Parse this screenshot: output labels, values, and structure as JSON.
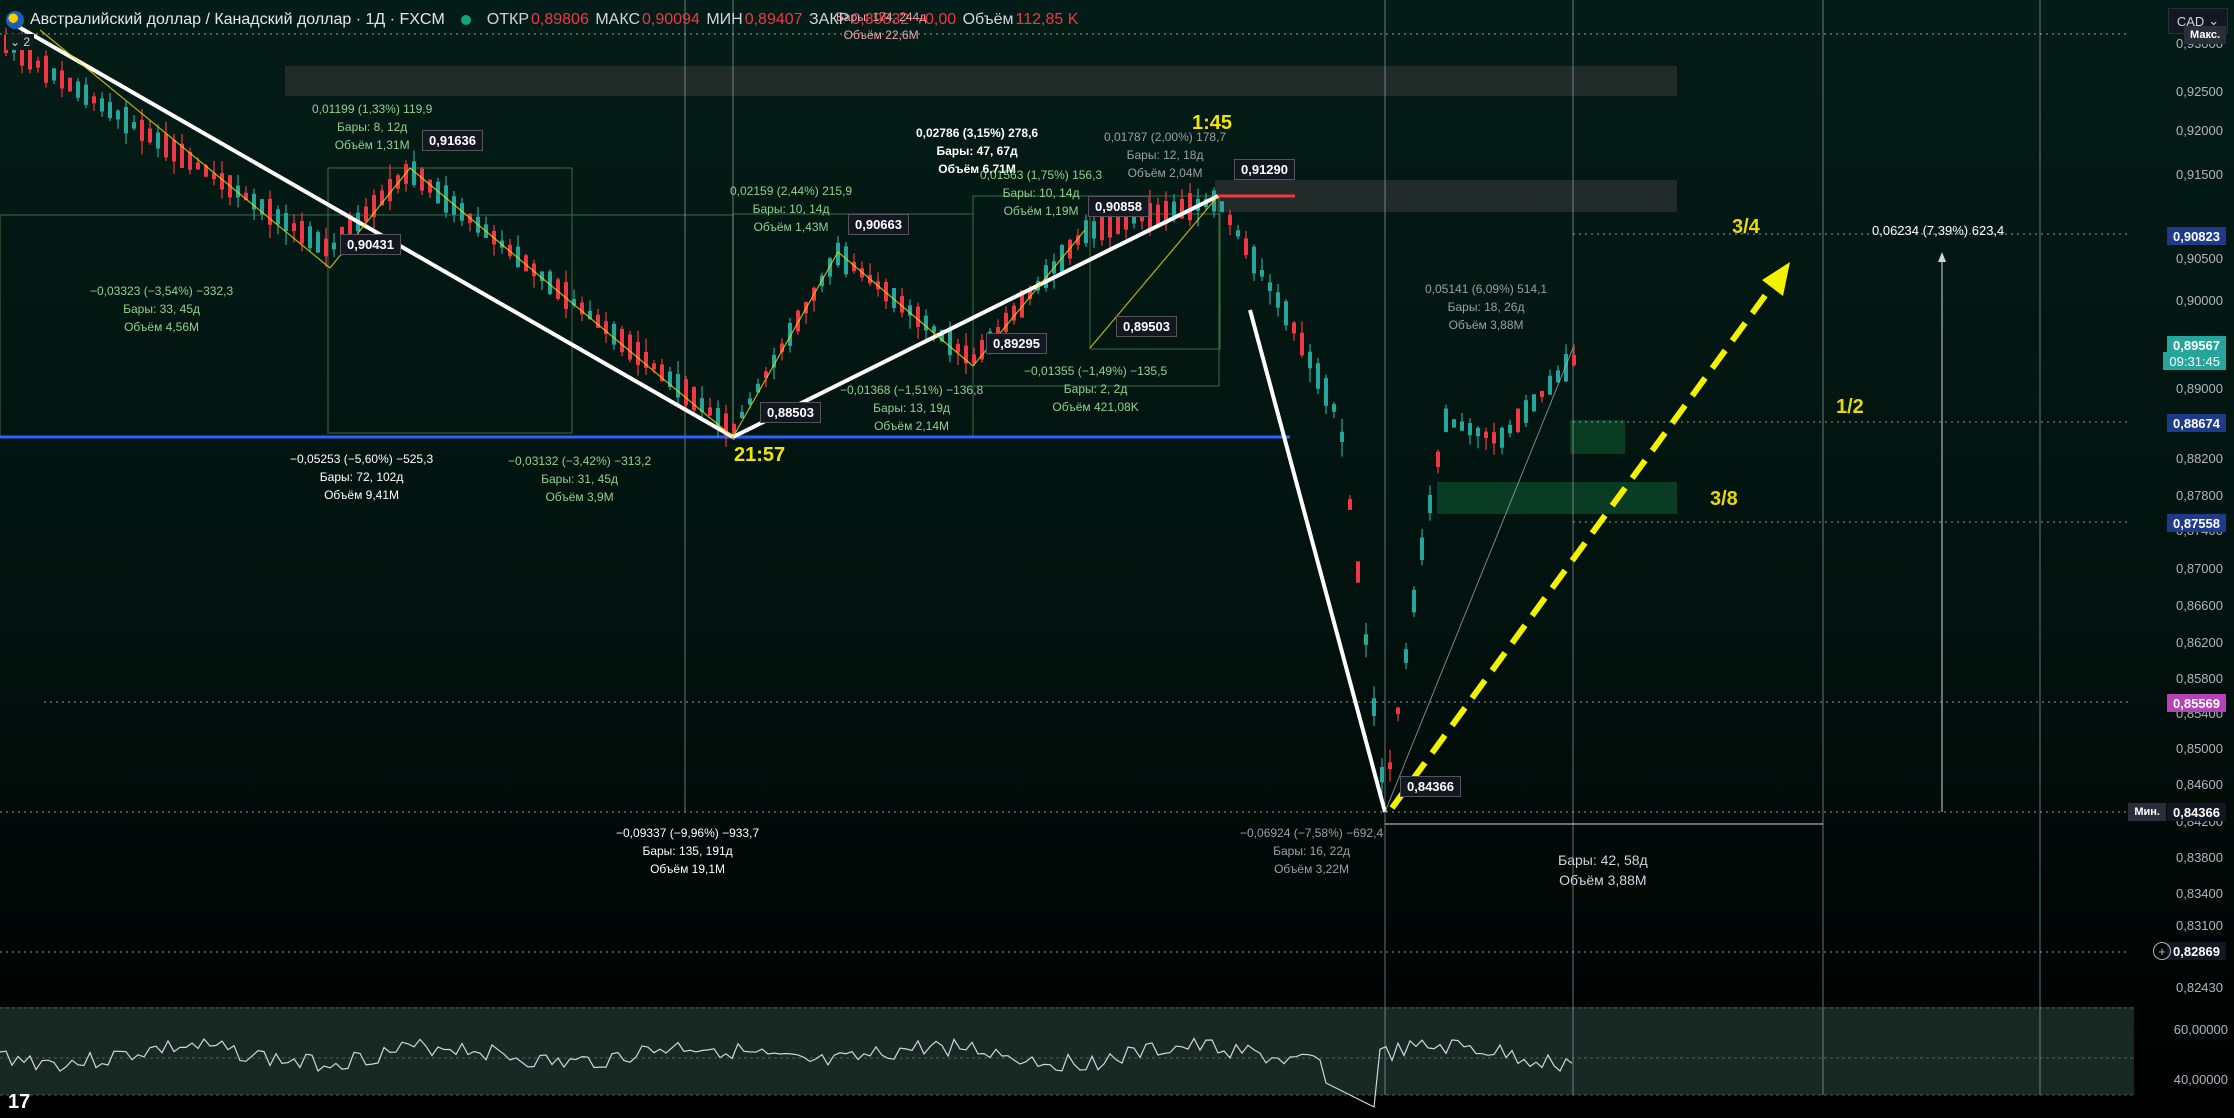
{
  "header": {
    "symbol": "Австралийский доллар / Канадский доллар · 1Д · FXCM",
    "open_label": "ОТКР",
    "open_value": "0,89806",
    "high_label": "МАКС",
    "high_value": "0,90094",
    "low_label": "МИН",
    "low_value": "0,89407",
    "close_label": "ЗАКР",
    "close_value": "0,89832",
    "change_value": "−0,00",
    "volume_label": "Объём",
    "volume_value": "112,85 K",
    "currency": "CAD",
    "layers_count": "2",
    "top_stat": "Бары: 174, 244д",
    "top_volume": "Объём 22,6M"
  },
  "price_axis": {
    "ticks": [
      "0,93000",
      "0,92500",
      "0,92000",
      "0,91500",
      "0,90500",
      "0,90000",
      "0,89000",
      "0,88200",
      "0,87800",
      "0,87400",
      "0,87000",
      "0,86600",
      "0,86200",
      "0,85800",
      "0,85400",
      "0,85000",
      "0,84600",
      "0,84200",
      "0,83800",
      "0,83400",
      "0,83100",
      "0,82430"
    ],
    "max_label": "Макс.",
    "min_label": "Мин.",
    "tags": {
      "p90823": "0,90823",
      "p89567": "0,89567",
      "countdown": "09:31:45",
      "p88674": "0,88674",
      "p87558": "0,87558",
      "p85569": "0,85569",
      "p84366": "0,84366",
      "p82869": "0,82869"
    }
  },
  "rsi_axis": {
    "t1": "60,00000",
    "t2": "40,00000"
  },
  "annotations": {
    "a1": [
      "0,01199 (1,33%) 119,9",
      "Бары: 8, 12д",
      "Объём 1,31M"
    ],
    "a2": [
      "−0,03323 (−3,54%) −332,3",
      "Бары: 33, 45д",
      "Объём 4,56M"
    ],
    "a3": [
      "−0,05253 (−5,60%) −525,3",
      "Бары: 72, 102д",
      "Объём 9,41M"
    ],
    "a4": [
      "−0,03132 (−3,42%) −313,2",
      "Бары: 31, 45д",
      "Объём 3,9M"
    ],
    "a5": [
      "0,02159 (2,44%) 215,9",
      "Бары: 10, 14д",
      "Объём 1,43M"
    ],
    "a6": [
      "0,02786 (3,15%) 278,6",
      "Бары: 47, 67д",
      "Объём 6,71M"
    ],
    "a7": [
      "0,01563 (1,75%) 156,3",
      "Бары: 10, 14д",
      "Объём 1,19M"
    ],
    "a8": [
      "0,01787 (2,00%) 178,7",
      "Бары: 12, 18д",
      "Объём 2,04M"
    ],
    "a9": [
      "−0,01368 (−1,51%) −136,8",
      "Бары: 13, 19д",
      "Объём 2,14M"
    ],
    "a10": [
      "−0,01355 (−1,49%) −135,5",
      "Бары: 2, 2д",
      "Объём 421,08K"
    ],
    "a11": [
      "−0,09337 (−9,96%) −933,7",
      "Бары: 135, 191д",
      "Объём 19,1M"
    ],
    "a12": [
      "−0,06924 (−7,58%) −692,4",
      "Бары: 16, 22д",
      "Объём 3,22M"
    ],
    "a13": [
      "0,05141 (6,09%) 514,1",
      "Бары: 18, 26д",
      "Объём 3,88M"
    ],
    "a14": [
      "0,06234 (7,39%) 623,4"
    ],
    "a15": [
      "Бары: 42, 58д",
      "Объём 3,88M"
    ]
  },
  "bubbles": {
    "b1": "0,91636",
    "b2": "0,90431",
    "b3": "0,90663",
    "b4": "0,88503",
    "b5": "0,89295",
    "b6": "0,90858",
    "b7": "0,89503",
    "b8": "0,91290",
    "b9": "0,84366"
  },
  "fib_labels": {
    "f34": "3/4",
    "f12": "1/2",
    "f38": "3/8"
  },
  "time_labels": {
    "t1": "1:45",
    "t2": "21:57"
  },
  "colors": {
    "up": "#26a69a",
    "down": "#f23645",
    "blue_line": "#2962ff",
    "fib": "#e8d900",
    "arrow": "#f2f200"
  }
}
